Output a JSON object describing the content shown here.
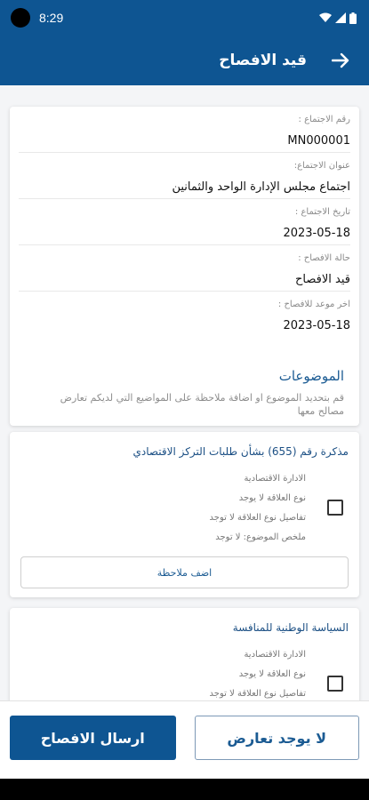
{
  "status": {
    "time": "8:29"
  },
  "header": {
    "title": "قيد الافصاح"
  },
  "details": [
    {
      "label": "رقم الاجتماع :",
      "value": "MN000001"
    },
    {
      "label": "عنوان الاجتماع:",
      "value": "اجتماع مجلس الإدارة الواحد والثمانين"
    },
    {
      "label": "تاريخ الاجتماع :",
      "value": "2023-05-18"
    },
    {
      "label": "حالة الافصاح :",
      "value": "قيد الافصاح"
    },
    {
      "label": "اخر موعد للافصاح :",
      "value": "2023-05-18"
    }
  ],
  "topics_section": {
    "title": "الموضوعات",
    "subtitle": "قم بتحديد الموضوع او اضافة ملاحظة على المواضيع التي لديكم تعارض مصالح معها"
  },
  "topics": [
    {
      "title": "مذكرة رقم (655) بشأن طلبات التركز الاقتصادي",
      "lines": [
        "الادارة الاقتصادية",
        "نوع العلاقة لا يوجد",
        "تفاصيل نوع العلاقة لا توجد",
        "ملخص الموضوع: لا توجد"
      ],
      "add_note": "اضف ملاحظة"
    },
    {
      "title": "السياسة الوطنية للمنافسة",
      "lines": [
        "الادارة الاقتصادية",
        "نوع العلاقة لا يوجد",
        "تفاصيل نوع العلاقة لا توجد"
      ]
    }
  ],
  "actions": {
    "submit": "ارسال الافصاح",
    "no_conflict": "لا يوجد تعارض"
  }
}
